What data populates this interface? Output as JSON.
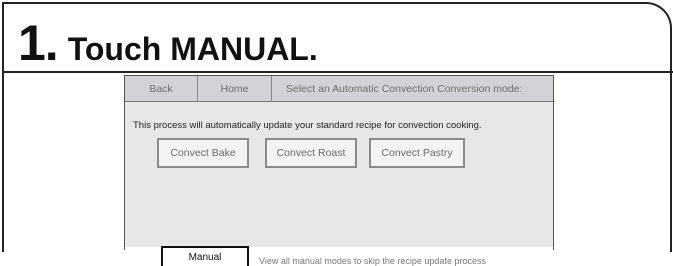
{
  "step": {
    "number": "1.",
    "text": "Touch MANUAL."
  },
  "screen": {
    "topbar": {
      "back_label": "Back",
      "home_label": "Home",
      "prompt": "Select an Automatic Convection Conversion mode:"
    },
    "info_text": "This process will automatically update your standard recipe for convection cooking.",
    "modes": [
      {
        "label": "Convect Bake"
      },
      {
        "label": "Convect Roast"
      },
      {
        "label": "Convect Pastry"
      }
    ],
    "manual": {
      "label": "Manual",
      "description": "View all manual modes to skip the recipe update process"
    }
  },
  "colors": {
    "panel_border": "#222222",
    "screen_bg": "#e7e7ea",
    "topbar_bg": "#d3d3d7"
  }
}
